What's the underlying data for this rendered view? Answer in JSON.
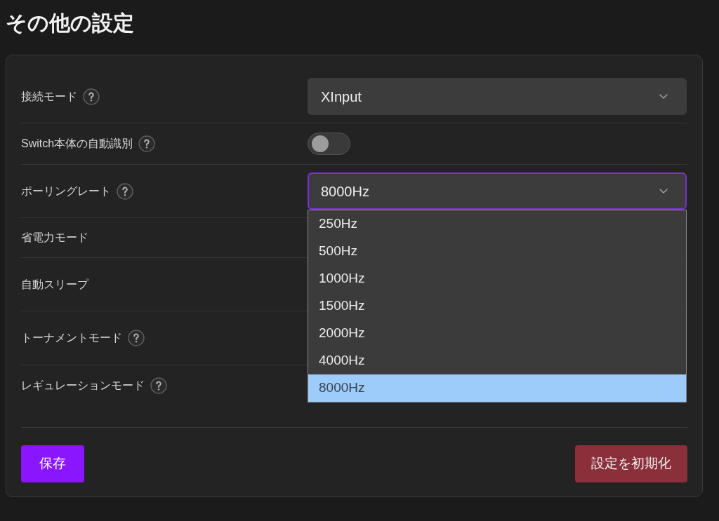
{
  "title": "その他の設定",
  "settings": [
    {
      "label": "接続モード",
      "help": true,
      "control": {
        "kind": "select",
        "value": "XInput",
        "open": false
      }
    },
    {
      "label": "Switch本体の自動識別",
      "help": true,
      "control": {
        "kind": "toggle",
        "on": false
      }
    },
    {
      "label": "ポーリングレート",
      "help": true,
      "control": {
        "kind": "select",
        "value": "8000Hz",
        "open": true,
        "options": [
          {
            "label": "250Hz",
            "selected": false
          },
          {
            "label": "500Hz",
            "selected": false
          },
          {
            "label": "1000Hz",
            "selected": false
          },
          {
            "label": "1500Hz",
            "selected": false
          },
          {
            "label": "2000Hz",
            "selected": false
          },
          {
            "label": "4000Hz",
            "selected": false
          },
          {
            "label": "8000Hz",
            "selected": true
          }
        ]
      }
    },
    {
      "label": "省電力モード",
      "help": false
    },
    {
      "label": "自動スリープ",
      "help": false
    },
    {
      "label": "トーナメントモード",
      "help": true
    },
    {
      "label": "レギュレーションモード",
      "help": true
    }
  ],
  "buttons": [
    {
      "label": "保存",
      "kind": "primary"
    },
    {
      "label": "設定を初期化",
      "kind": "danger"
    }
  ]
}
